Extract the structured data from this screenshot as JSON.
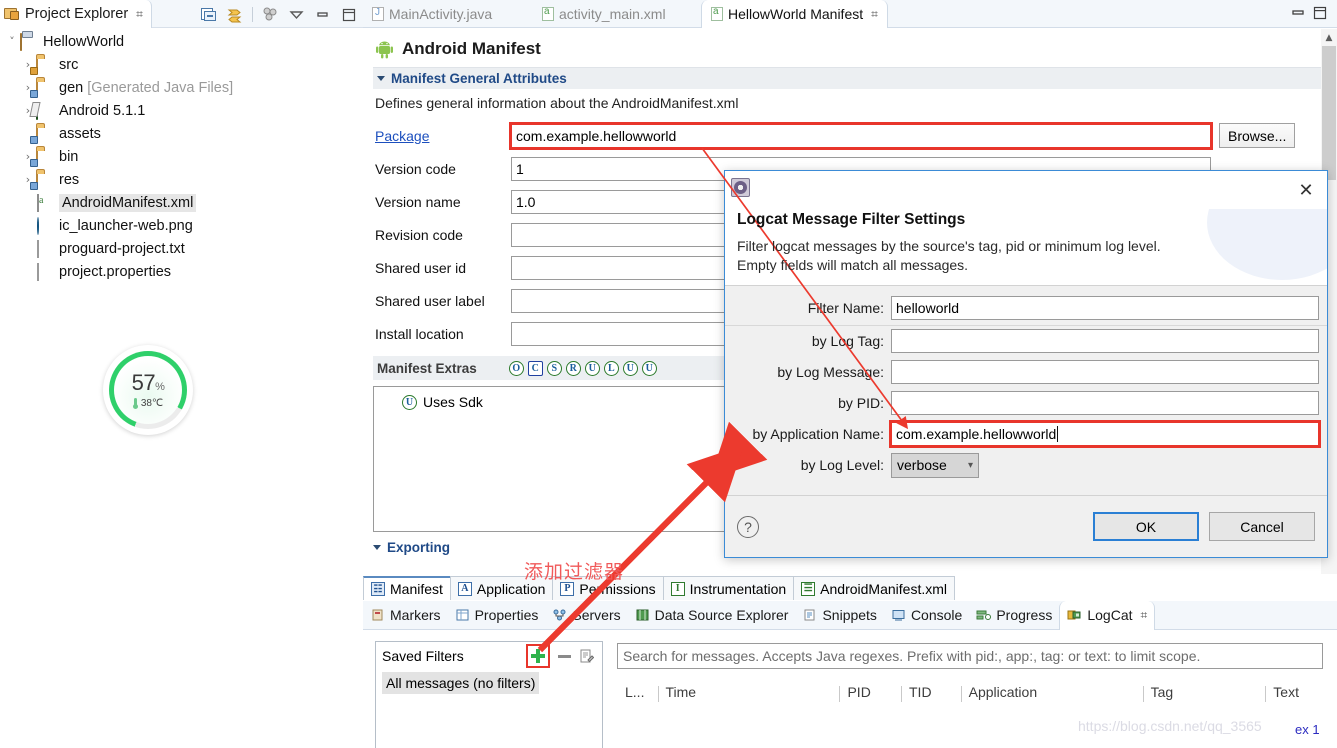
{
  "explorer": {
    "tab_label": "Project Explorer",
    "close_glyph": "⌗",
    "toolbar": [
      {
        "name": "collapse-all-icon"
      },
      {
        "name": "link-with-editor-icon"
      },
      {
        "name": "view-menu-filters-icon"
      },
      {
        "name": "view-menu-icon"
      },
      {
        "name": "minimize-icon"
      },
      {
        "name": "maximize-icon"
      }
    ],
    "tree": [
      {
        "label": "HellowWorld",
        "arrow": "˅",
        "icon": "project-icon",
        "depth": 0,
        "selected": false
      },
      {
        "label": "src",
        "arrow": "›",
        "icon": "source-folder-icon",
        "depth": 1,
        "selected": false
      },
      {
        "label": "gen ",
        "dim": "[Generated Java Files]",
        "arrow": "›",
        "icon": "gen-folder-icon",
        "depth": 1,
        "selected": false
      },
      {
        "label": "Android 5.1.1",
        "arrow": "›",
        "icon": "library-icon",
        "depth": 1,
        "selected": false
      },
      {
        "label": "assets",
        "arrow": "",
        "icon": "folder-icon",
        "depth": 1,
        "selected": false
      },
      {
        "label": "bin",
        "arrow": "›",
        "icon": "folder-icon",
        "depth": 1,
        "selected": false
      },
      {
        "label": "res",
        "arrow": "›",
        "icon": "folder-icon",
        "depth": 1,
        "selected": false
      },
      {
        "label": "AndroidManifest.xml",
        "arrow": "",
        "icon": "xml-file-icon",
        "depth": 1,
        "selected": true
      },
      {
        "label": "ic_launcher-web.png",
        "arrow": "",
        "icon": "image-file-icon",
        "depth": 1,
        "selected": false
      },
      {
        "label": "proguard-project.txt",
        "arrow": "",
        "icon": "text-file-icon",
        "depth": 1,
        "selected": false
      },
      {
        "label": "project.properties",
        "arrow": "",
        "icon": "text-file-icon",
        "depth": 1,
        "selected": false
      }
    ]
  },
  "cpu_widget": {
    "percent": "57",
    "percent_unit": "%",
    "temperature": "38℃",
    "ring_color": "#2fd06a",
    "ring_value": 57
  },
  "editor": {
    "tabs": [
      {
        "label": "MainActivity.java",
        "icon": "java-file-icon",
        "active": false
      },
      {
        "label": "activity_main.xml",
        "icon": "xml-file-icon",
        "active": false
      },
      {
        "label": "HellowWorld Manifest",
        "icon": "xml-file-icon",
        "active": true,
        "close_glyph": "⌗"
      }
    ],
    "window_minimize": "minimize-icon",
    "window_maximize": "maximize-icon",
    "title": "Android Manifest",
    "section_general": {
      "label": "Manifest General Attributes",
      "description": "Defines general information about the AndroidManifest.xml"
    },
    "fields": [
      {
        "label": "Package",
        "value": "com.example.hellowworld",
        "is_link": true,
        "highlight": true,
        "has_browse": true
      },
      {
        "label": "Version code",
        "value": "1",
        "is_link": false,
        "highlight": false,
        "has_browse": false
      },
      {
        "label": "Version name",
        "value": "1.0",
        "is_link": false,
        "highlight": false,
        "has_browse": false
      },
      {
        "label": "Revision code",
        "value": "",
        "is_link": false,
        "highlight": false,
        "has_browse": false
      },
      {
        "label": "Shared user id",
        "value": "",
        "is_link": false,
        "highlight": false,
        "has_browse": false
      },
      {
        "label": "Shared user label",
        "value": "",
        "is_link": false,
        "highlight": false,
        "has_browse": false
      },
      {
        "label": "Install location",
        "value": "",
        "is_link": false,
        "highlight": false,
        "has_browse": false
      }
    ],
    "browse_label": "Browse...",
    "section_extras": {
      "label": "Manifest Extras",
      "icons": [
        "O",
        "C",
        "S",
        "R",
        "U",
        "L",
        "U",
        "U"
      ],
      "items": [
        {
          "badge": "U",
          "label": "Uses Sdk"
        }
      ]
    },
    "section_exporting": {
      "label": "Exporting"
    },
    "page_tabs": [
      {
        "label": "Manifest",
        "badge": "☷",
        "active": true
      },
      {
        "label": "Application",
        "badge": "A",
        "active": false
      },
      {
        "label": "Permissions",
        "badge": "P",
        "active": false
      },
      {
        "label": "Instrumentation",
        "badge": "I",
        "active": false
      },
      {
        "label": "AndroidManifest.xml",
        "badge": "☰",
        "active": false
      }
    ]
  },
  "bottom_panel": {
    "tabs": [
      {
        "label": "Markers",
        "icon": "markers-icon",
        "active": false
      },
      {
        "label": "Properties",
        "icon": "properties-icon",
        "active": false
      },
      {
        "label": "Servers",
        "icon": "servers-icon",
        "active": false
      },
      {
        "label": "Data Source Explorer",
        "icon": "datasource-icon",
        "active": false
      },
      {
        "label": "Snippets",
        "icon": "snippets-icon",
        "active": false
      },
      {
        "label": "Console",
        "icon": "console-icon",
        "active": false
      },
      {
        "label": "Progress",
        "icon": "progress-icon",
        "active": false
      },
      {
        "label": "LogCat",
        "icon": "logcat-icon",
        "active": true,
        "close_glyph": "⌗"
      }
    ],
    "saved_filters": {
      "title": "Saved Filters",
      "add_icon": "plus-icon",
      "remove_icon": "minus-icon",
      "edit_icon": "edit-icon",
      "items": [
        "All messages (no filters)"
      ]
    },
    "search_placeholder": "Search for messages. Accepts Java regexes. Prefix with pid:, app:, tag: or text: to limit scope.",
    "columns": [
      "L...",
      "Time",
      "PID",
      "TID",
      "Application",
      "Tag",
      "Text"
    ]
  },
  "dialog": {
    "icon": "settings-gear-icon",
    "close_glyph": "✕",
    "title": "Logcat Message Filter Settings",
    "description_line1": "Filter logcat messages by the source's tag, pid or minimum log level.",
    "description_line2": "Empty fields will match all messages.",
    "fields": [
      {
        "label": "Filter Name:",
        "value": "helloworld",
        "type": "text",
        "highlight": false,
        "focused": false
      },
      {
        "label": "by Log Tag:",
        "value": "",
        "type": "text",
        "highlight": false,
        "focused": false
      },
      {
        "label": "by Log Message:",
        "value": "",
        "type": "text",
        "highlight": false,
        "focused": false
      },
      {
        "label": "by PID:",
        "value": "",
        "type": "text",
        "highlight": false,
        "focused": false
      },
      {
        "label": "by Application Name:",
        "value": "com.example.hellowworld",
        "type": "text",
        "highlight": true,
        "focused": true
      },
      {
        "label": "by Log Level:",
        "value": "verbose",
        "type": "select",
        "highlight": false,
        "focused": false
      }
    ],
    "help_glyph": "?",
    "ok_label": "OK",
    "cancel_label": "Cancel"
  },
  "annotations": {
    "note_cn": "添加过滤器",
    "accent_red": "#e8352b",
    "watermark": "https://blog.csdn.net/qq_3565",
    "watermark_tail": "ex 1"
  }
}
